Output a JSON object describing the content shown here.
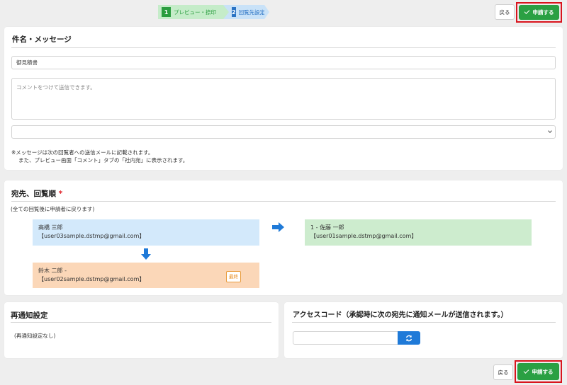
{
  "stepper": {
    "steps": [
      {
        "num": "1",
        "label": "プレビュー・捺印"
      },
      {
        "num": "2",
        "label": "回覧先設定"
      }
    ]
  },
  "actions": {
    "back_label": "戻る",
    "apply_label": "申請する"
  },
  "subject_section": {
    "title": "件名・メッセージ",
    "subject_value": "御見積書",
    "comment_placeholder": "コメントをつけて送信できます。",
    "select_value": "",
    "note_line1": "※メッセージは次の回覧者への送信メールに記載されます。",
    "note_line2": "また、プレビュー画面「コメント」タブの「社内宛」に表示されます。"
  },
  "route_section": {
    "title": "宛先、回覧順",
    "required_mark": "*",
    "subtitle": "(全ての回覧後に申請者に戻ります)",
    "recipients": [
      {
        "name": "高橋 三郎",
        "email": "【user03sample.dstmp@gmail.com】"
      },
      {
        "name": "鈴木 二郎 -",
        "email": "【user02sample.dstmp@gmail.com】",
        "badge": "最終"
      },
      {
        "name": "1 - 佐藤 一郎",
        "email": "【user01sample.dstmp@gmail.com】"
      }
    ]
  },
  "renotify_section": {
    "title": "再通知設定",
    "value": "(再通知設定なし)"
  },
  "access_code_section": {
    "title": "アクセスコード（承認時に次の宛先に通知メールが送信されます。）",
    "input_value": ""
  },
  "colors": {
    "accent_green": "#2aa043",
    "highlight_red": "#d9141d",
    "arrow_blue": "#1f7ad8"
  }
}
